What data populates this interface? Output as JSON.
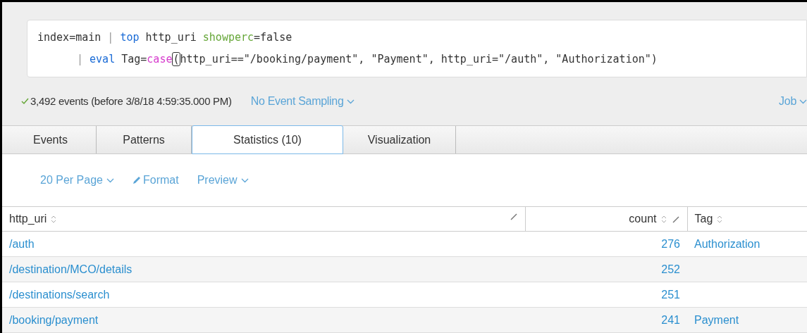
{
  "query": {
    "lines": [
      [
        {
          "text": "index=main ",
          "kind": "plain"
        },
        {
          "text": "| ",
          "kind": "pipe"
        },
        {
          "text": "top",
          "kind": "command"
        },
        {
          "text": " http_uri ",
          "kind": "plain"
        },
        {
          "text": "showperc",
          "kind": "argument"
        },
        {
          "text": "=false",
          "kind": "plain"
        }
      ],
      [
        {
          "text": "| ",
          "kind": "pipe"
        },
        {
          "text": "eval",
          "kind": "command"
        },
        {
          "text": " Tag=",
          "kind": "plain"
        },
        {
          "text": "case",
          "kind": "function"
        },
        {
          "text": "(",
          "kind": "cursor"
        },
        {
          "text": "http_uri==\"/booking/payment\", \"Payment\", http_uri=\"/auth\", \"Authorization\")",
          "kind": "plain"
        }
      ]
    ]
  },
  "status": {
    "events": "3,492 events (before 3/8/18 4:59:35.000 PM)",
    "sampling": "No Event Sampling",
    "job": "Job"
  },
  "tabs": [
    {
      "label": "Events",
      "selected": false
    },
    {
      "label": "Patterns",
      "selected": false
    },
    {
      "label": "Statistics (10)",
      "selected": true
    },
    {
      "label": "Visualization",
      "selected": false
    }
  ],
  "toolbar": {
    "per_page": "20 Per Page",
    "format": "Format",
    "preview": "Preview"
  },
  "table": {
    "columns": [
      {
        "label": "http_uri",
        "kind": "text"
      },
      {
        "label": "count",
        "kind": "number"
      },
      {
        "label": "Tag",
        "kind": "text"
      }
    ],
    "rows": [
      [
        "/auth",
        "276",
        "Authorization"
      ],
      [
        "/destination/MCO/details",
        "252",
        ""
      ],
      [
        "/destinations/search",
        "251",
        ""
      ],
      [
        "/booking/payment",
        "241",
        "Payment"
      ]
    ]
  }
}
